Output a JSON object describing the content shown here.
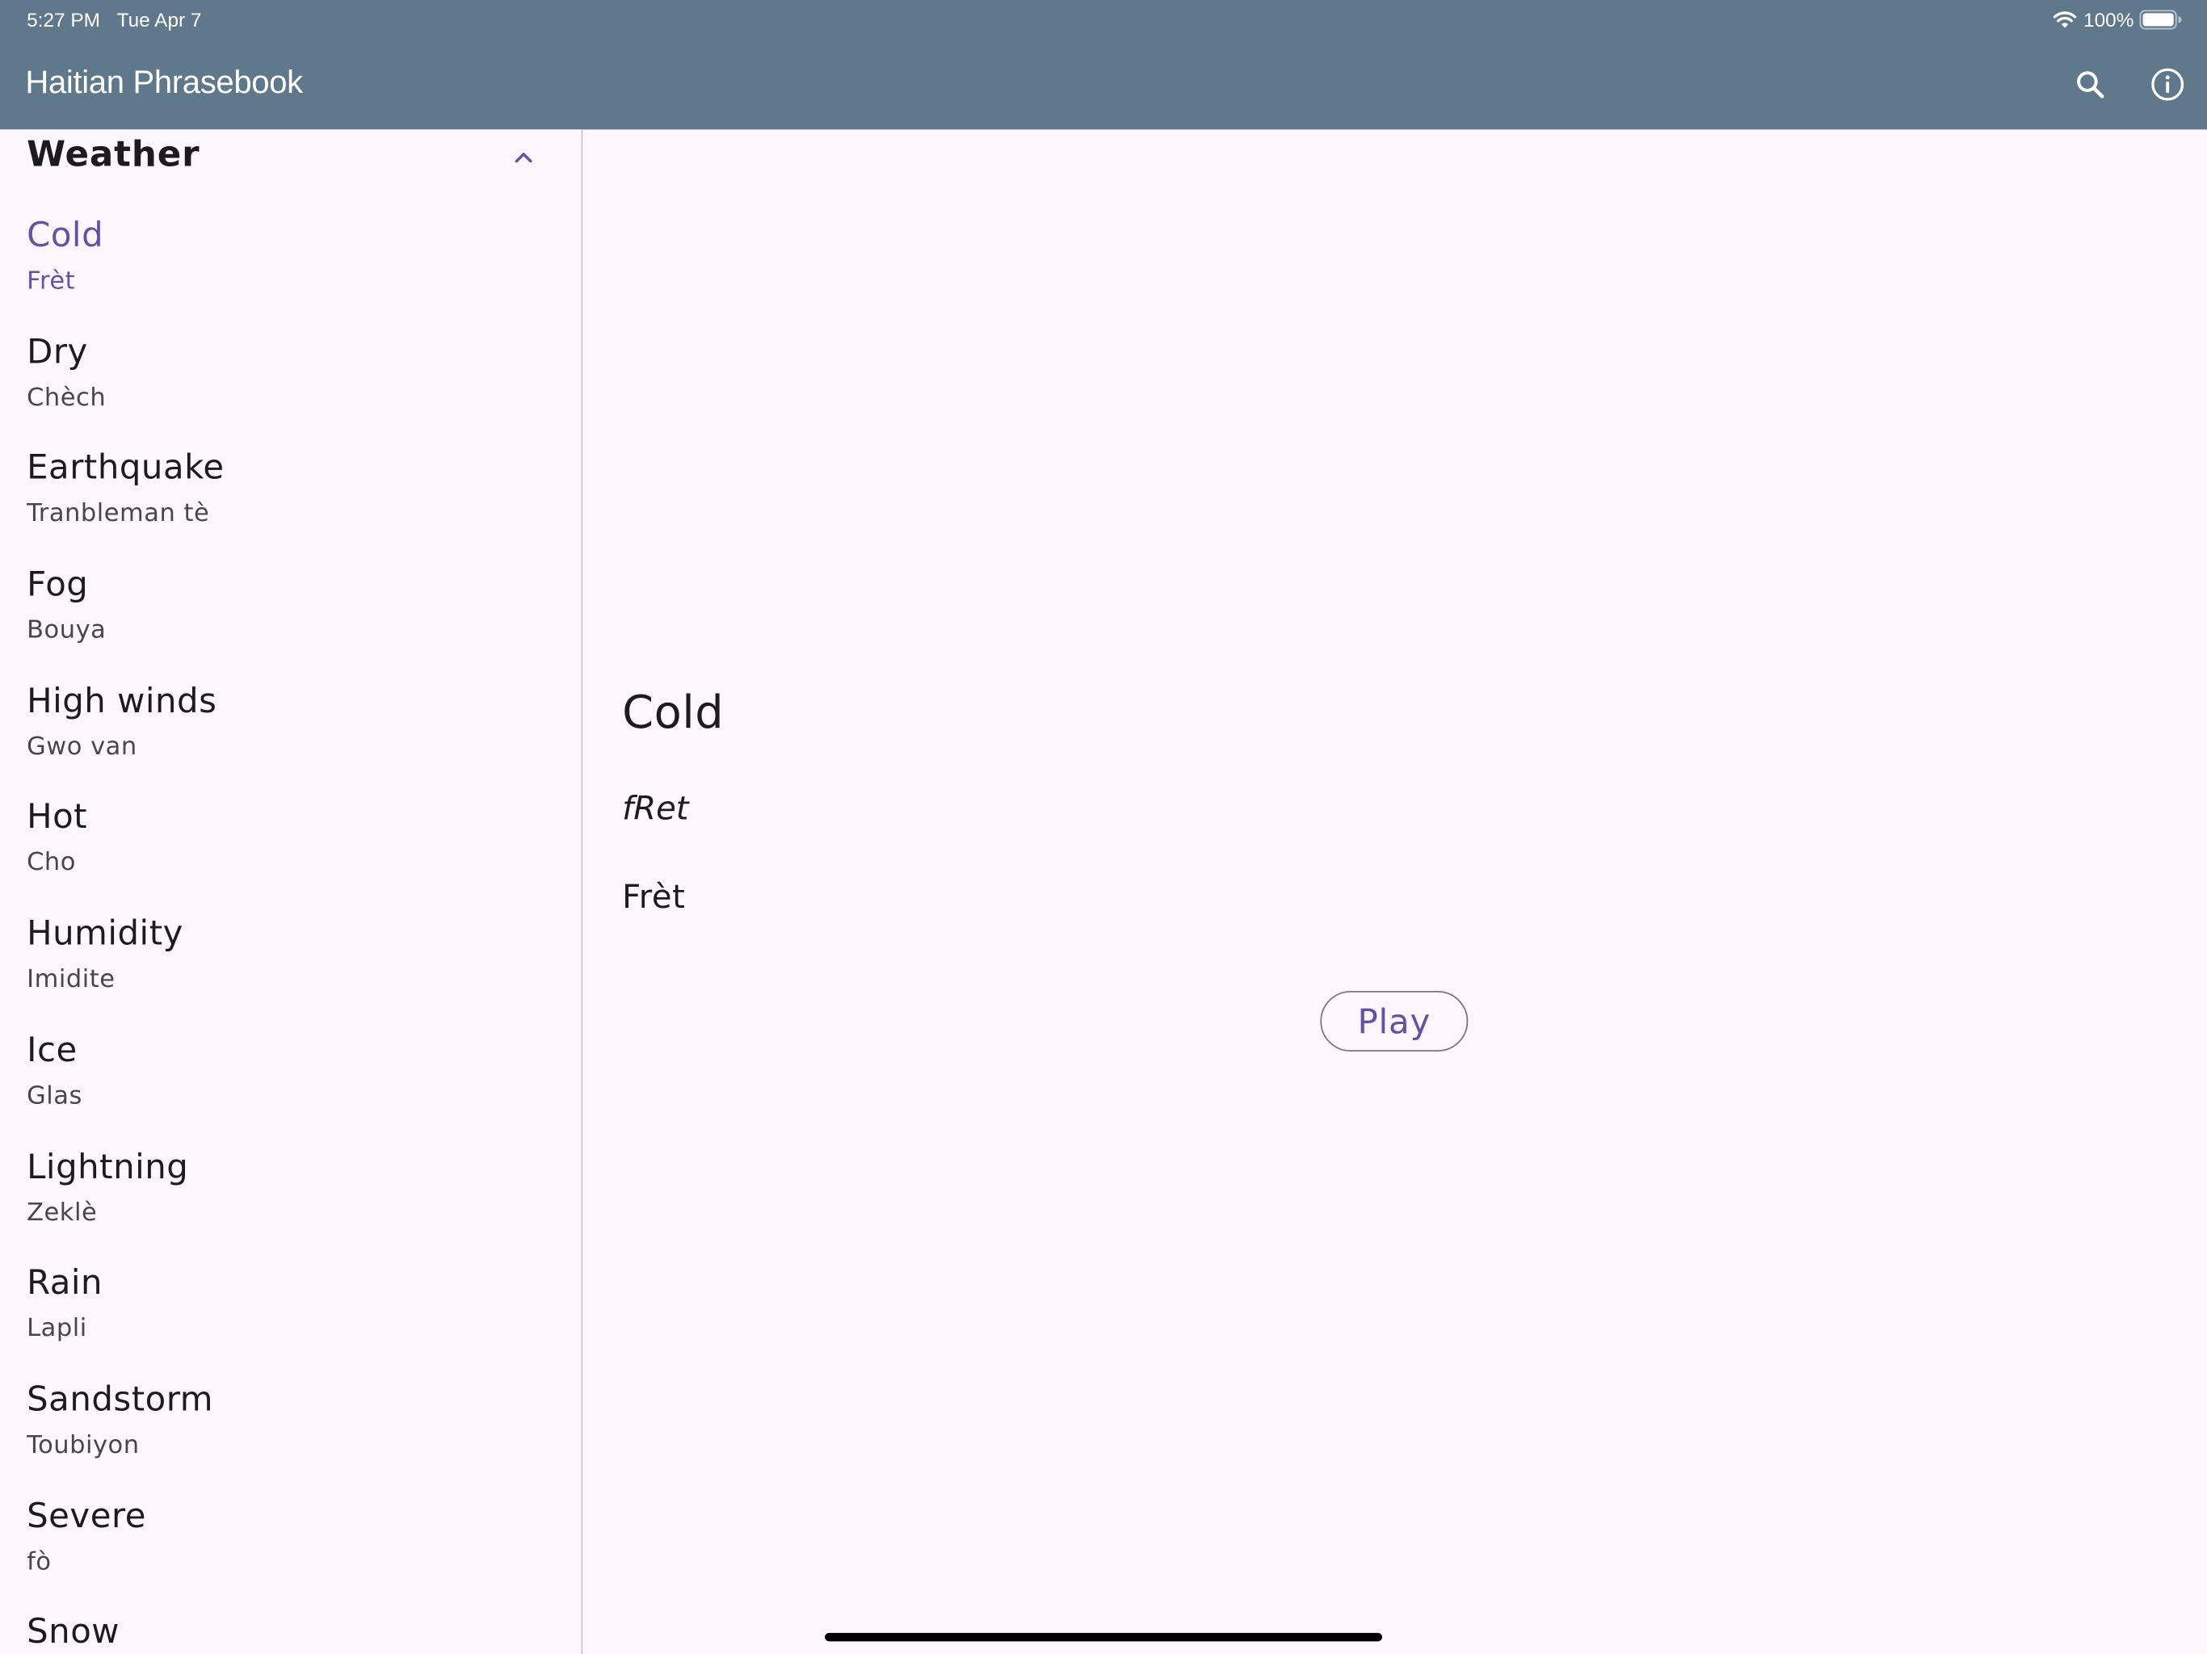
{
  "status_bar": {
    "time": "5:27 PM",
    "date": "Tue Apr 7",
    "battery": "100%",
    "icons": [
      "wifi-icon",
      "battery-icon"
    ]
  },
  "app_bar": {
    "title": "Haitian Phrasebook",
    "background_color": "#60788c",
    "icons": [
      "search-icon",
      "info-icon"
    ]
  },
  "sidebar": {
    "section_title": "Weather",
    "section_icon": "chevron-up-icon",
    "selected_color": "#6750a4",
    "items": [
      {
        "english": "Cold",
        "haitian": "Frèt",
        "selected": true
      },
      {
        "english": "Dry",
        "haitian": "Chèch"
      },
      {
        "english": "Earthquake",
        "haitian": "Tranbleman tè"
      },
      {
        "english": "Fog",
        "haitian": "Bouya"
      },
      {
        "english": "High winds",
        "haitian": "Gwo van"
      },
      {
        "english": "Hot",
        "haitian": "Cho"
      },
      {
        "english": "Humidity",
        "haitian": "Imidite"
      },
      {
        "english": "Ice",
        "haitian": "Glas"
      },
      {
        "english": "Lightning",
        "haitian": "Zeklè"
      },
      {
        "english": "Rain",
        "haitian": "Lapli"
      },
      {
        "english": "Sandstorm",
        "haitian": "Toubiyon"
      },
      {
        "english": "Severe",
        "haitian": "fò"
      },
      {
        "english": "Snow",
        "haitian": ""
      }
    ]
  },
  "detail": {
    "english": "Cold",
    "phonetic": "fRet",
    "haitian": "Frèt",
    "play_label": "Play"
  }
}
